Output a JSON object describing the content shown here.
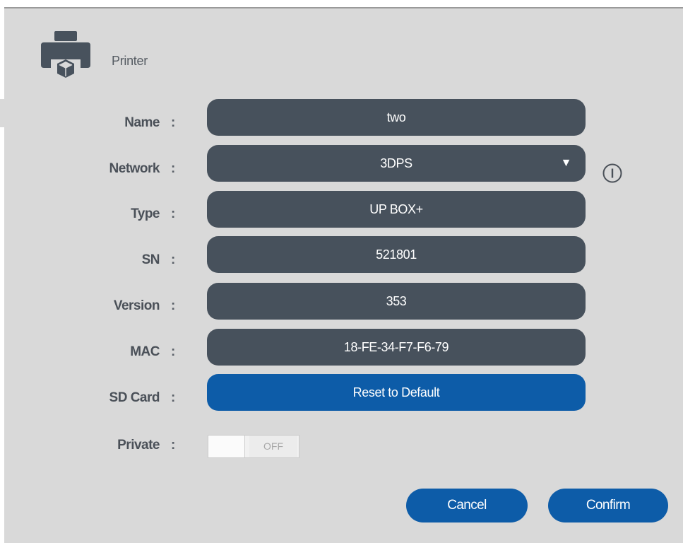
{
  "header": {
    "title": "Printer",
    "icon": "printer-icon"
  },
  "colon": ":",
  "fields": {
    "name": {
      "label": "Name",
      "value": "two"
    },
    "network": {
      "label": "Network",
      "value": "3DPS",
      "arrow": "▼"
    },
    "type": {
      "label": "Type",
      "value": "UP BOX+"
    },
    "sn": {
      "label": "SN",
      "value": "521801"
    },
    "version": {
      "label": "Version",
      "value": "353"
    },
    "mac": {
      "label": "MAC",
      "value": "18-FE-34-F7-F6-79"
    },
    "sd_card": {
      "label": "SD Card",
      "button_label": "Reset to Default"
    },
    "private": {
      "label": "Private",
      "toggle_state": "OFF"
    }
  },
  "buttons": {
    "cancel": "Cancel",
    "confirm": "Confirm"
  },
  "colors": {
    "dialog_bg": "#d9d9d9",
    "field_bg": "#47515c",
    "accent_blue": "#0d5ca8"
  }
}
